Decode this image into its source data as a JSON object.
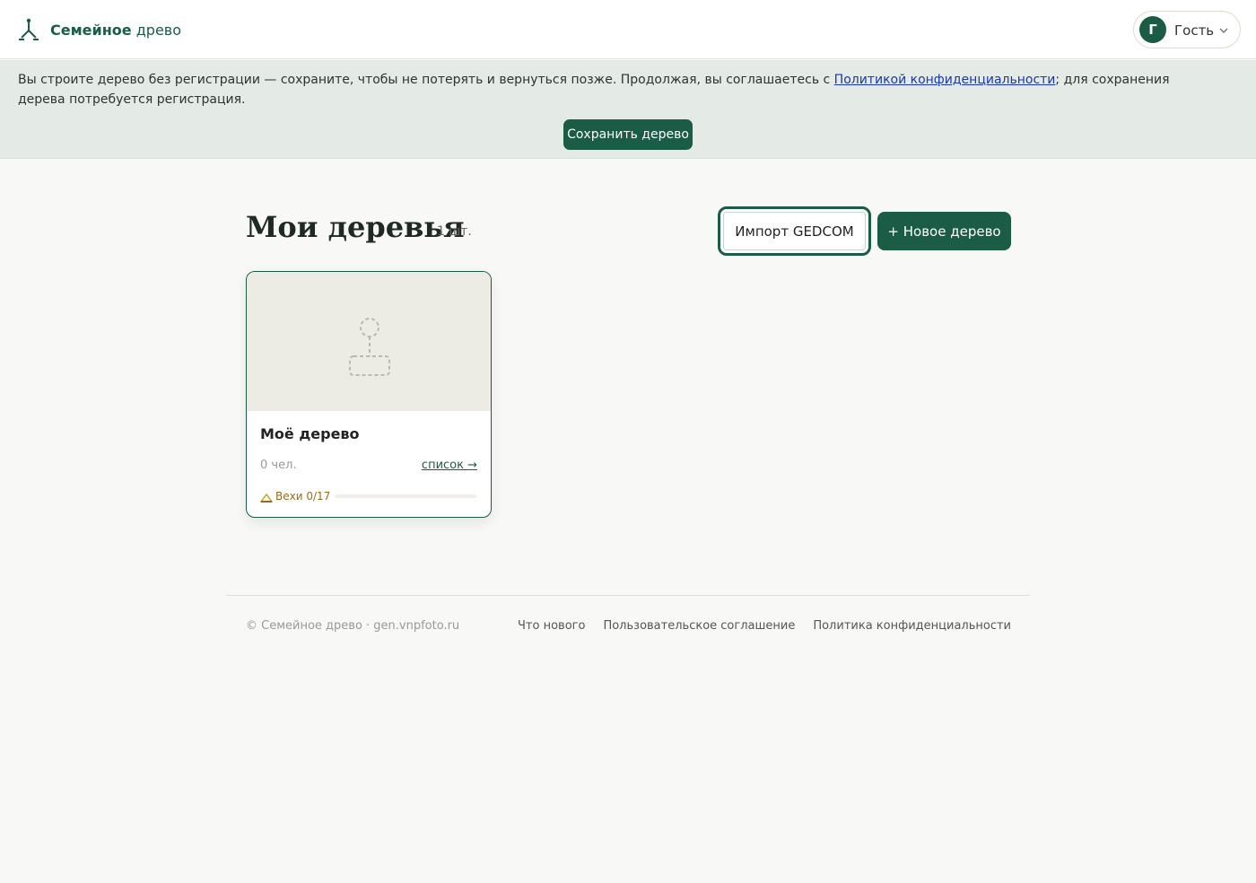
{
  "colors": {
    "brand": "#1a5c45",
    "banner_bg": "#e4ebe6",
    "milestone": "#c9a43a",
    "link": "#1a37b8"
  },
  "header": {
    "logo_bold": "Семейное",
    "logo_rest": " древо",
    "user": {
      "initial": "Г",
      "name": "Гость"
    }
  },
  "banner": {
    "text_before": "Вы строите дерево без регистрации — сохраните, чтобы не потерять и вернуться позже. Продолжая, вы соглашаетесь с ",
    "link": "Политикой конфиденциальности",
    "text_after": "; для сохранения дерева потребуется регистрация.",
    "save_button": "Сохранить дерево"
  },
  "main": {
    "title": "Мои деревья",
    "count": "1 шт.",
    "import_button": "Импорт GEDCOM",
    "new_button": "+ Новое дерево",
    "trees": [
      {
        "title": "Моё дерево",
        "people": "0 чел.",
        "link": "список →",
        "milestones_label": "Вехи 0/17",
        "milestones_done": 0,
        "milestones_total": 17
      }
    ]
  },
  "footer": {
    "copyright": "© Семейное древо · gen.vnpfoto.ru",
    "links": [
      "Что нового",
      "Пользовательское соглашение",
      "Политика конфиденциальности"
    ]
  }
}
